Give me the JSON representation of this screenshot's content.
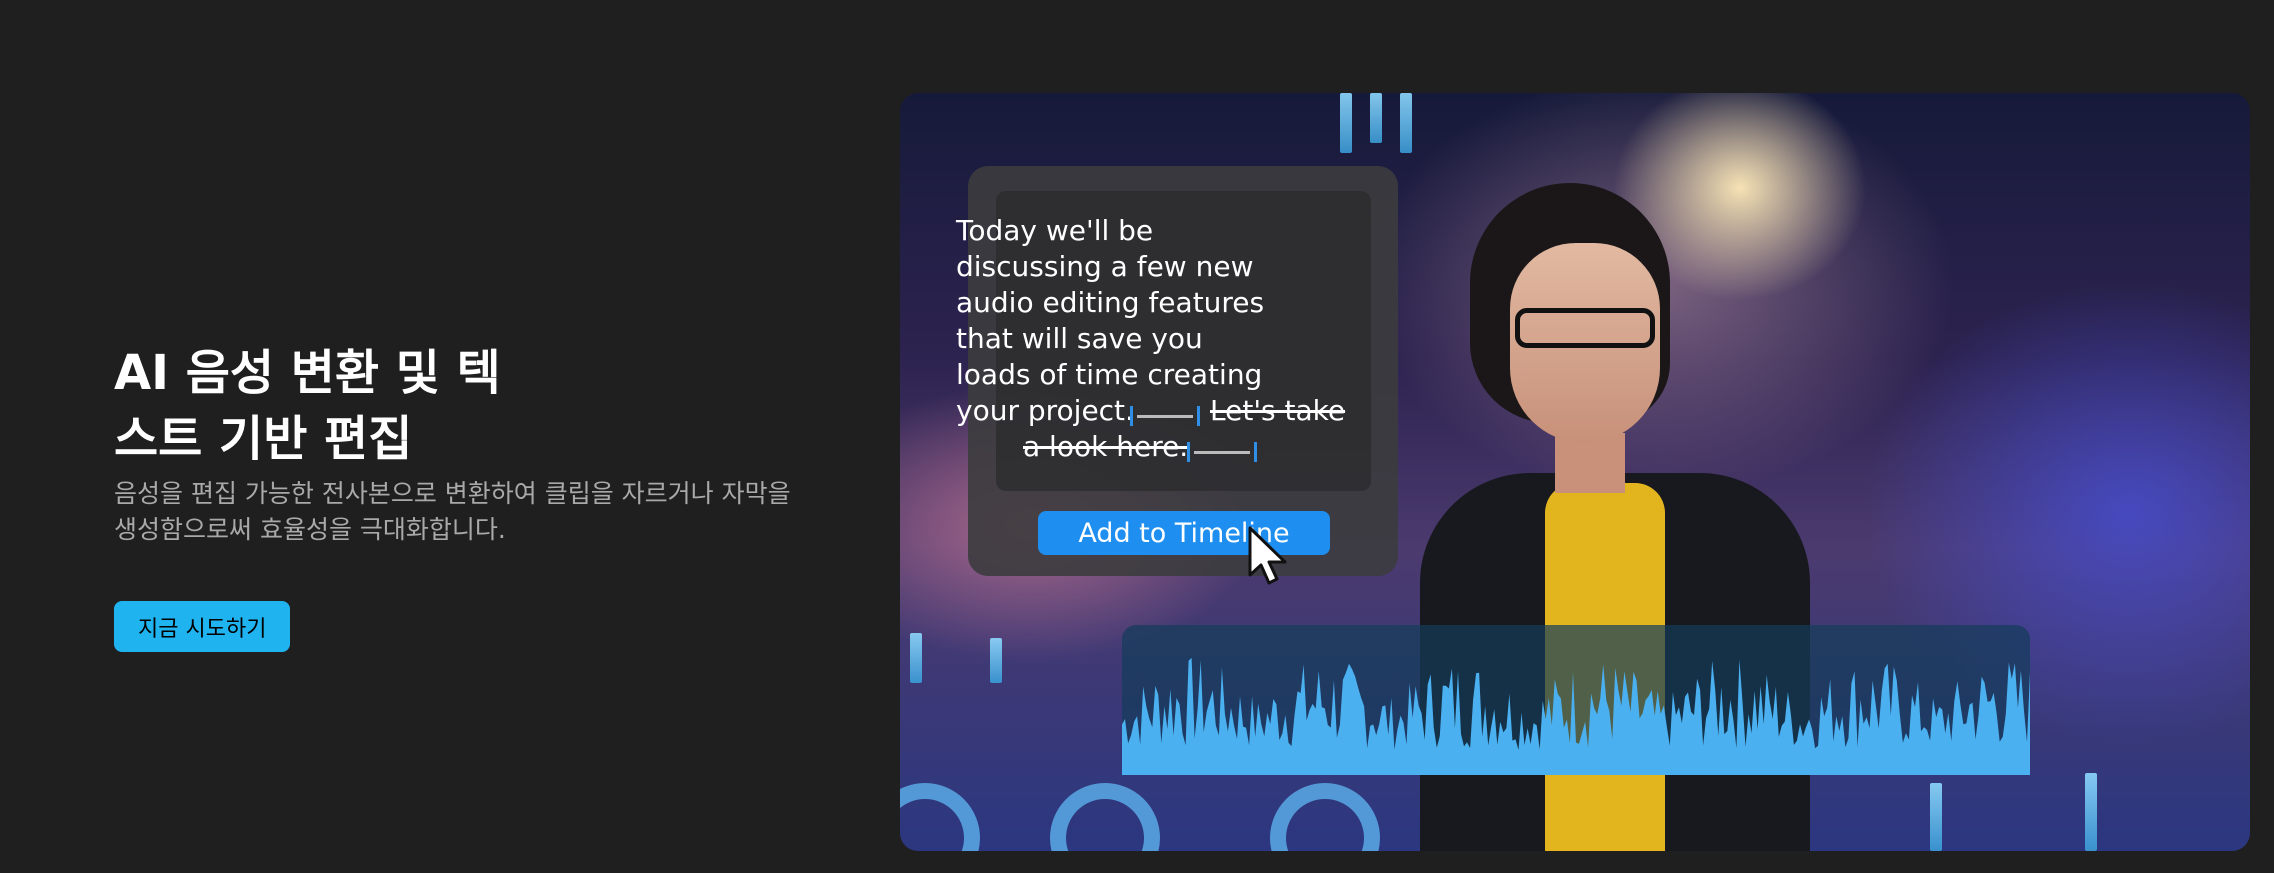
{
  "hero": {
    "title": "AI 음성 변환 및 텍스트 기반 편집",
    "description": "음성을 편집 가능한 전사본으로 변환하여 클립을 자르거나 자막을 생성함으로써 효율성을 극대화합니다.",
    "cta_label": "지금 시도하기"
  },
  "media": {
    "transcript_text": "Today we'll be discussing a few new audio editing features that will save you loads of time creating your project.",
    "struck_text_line1": "Let's take",
    "struck_text_line2": "a look here.",
    "add_button_label": "Add to Timeline"
  },
  "colors": {
    "page_bg": "#1f1f1f",
    "accent_cta": "#1fb3f0",
    "add_button": "#1e8ff0",
    "waveform": "#4ab0f0",
    "gap_marker": "#2f8fe6"
  },
  "icons": [
    "cursor-arrow-icon",
    "waveform-icon"
  ]
}
